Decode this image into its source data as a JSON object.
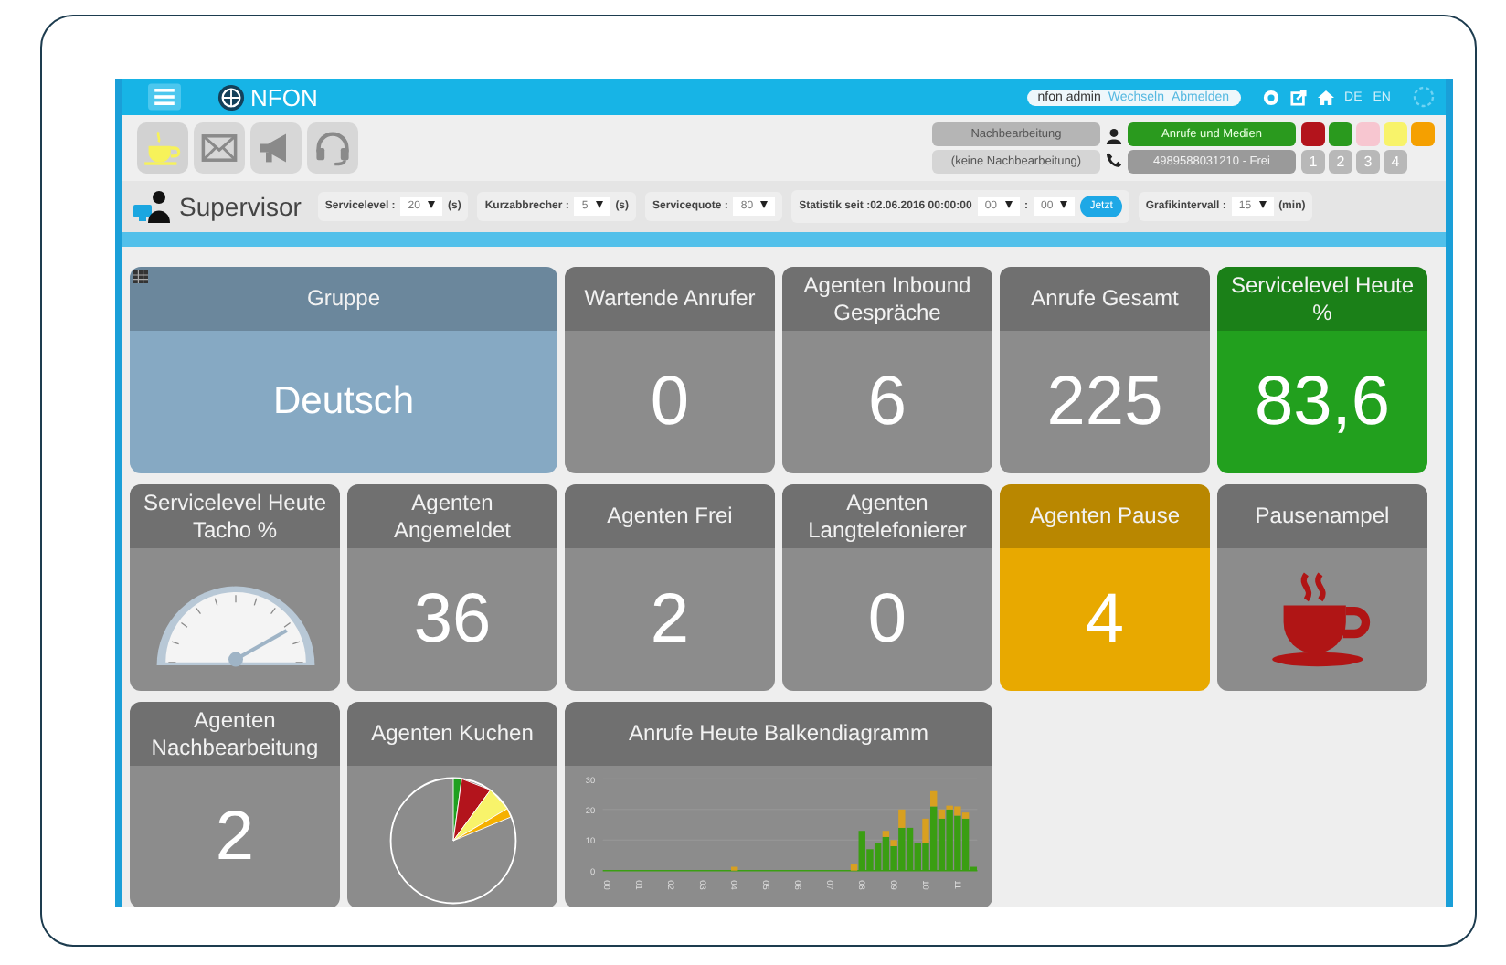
{
  "header": {
    "logo": "NFON",
    "user": "nfon admin",
    "links": [
      "Wechseln",
      "Abmelden"
    ],
    "languages": [
      "DE",
      "EN"
    ]
  },
  "toolbar": {
    "modes": [
      {
        "kind": "coffee",
        "selected": true
      },
      {
        "kind": "mail",
        "selected": false
      },
      {
        "kind": "megaphone",
        "selected": false
      },
      {
        "kind": "headset",
        "selected": false
      }
    ],
    "wrapup": {
      "button": "Nachbearbeitung",
      "status": "(keine Nachbearbeitung)"
    },
    "media": {
      "button": "Anrufe und Medien",
      "line": "4989588031210 - Frei"
    },
    "status_colors": [
      {
        "color": "#b3141c"
      },
      {
        "color": "#2a9a1e"
      },
      {
        "color": "#f7c6d0"
      },
      {
        "color": "#f8f36a"
      },
      {
        "color": "#f5a000"
      }
    ],
    "lines": [
      "1",
      "2",
      "3",
      "4"
    ]
  },
  "supervisor": {
    "title": "Supervisor",
    "settings": [
      {
        "label": "Servicelevel :",
        "value": "20",
        "unit": "(s)"
      },
      {
        "label": "Kurzabbrecher :",
        "value": "5",
        "unit": "(s)"
      },
      {
        "label": "Servicequote :",
        "value": "80"
      }
    ],
    "since": {
      "label": "Statistik seit :02.06.2016 00:00:00",
      "hour": "00",
      "separator": ":",
      "minute": "00",
      "button": "Jetzt"
    },
    "interval": {
      "label": "Grafikintervall :",
      "value": "15",
      "unit": "(min)"
    }
  },
  "tiles": [
    {
      "kind": "text",
      "title": "Gruppe",
      "value": "Deutsch",
      "color": "#86a9c3",
      "wide": true
    },
    {
      "kind": "number",
      "title": "Wartende Anrufer",
      "value": "0",
      "color": "#8c8c8c",
      "wide": false
    },
    {
      "kind": "number",
      "title": "Agenten Inbound Gespräche",
      "value": "6",
      "color": "#8c8c8c",
      "wide": false
    },
    {
      "kind": "number",
      "title": "Anrufe Gesamt",
      "value": "225",
      "color": "#8c8c8c",
      "wide": false
    },
    {
      "kind": "number",
      "title": "Servicelevel Heute %",
      "value": "83,6",
      "color": "#22a01e",
      "wide": false
    },
    {
      "kind": "gauge",
      "title": "Servicelevel Heute Tacho %",
      "level": 0.836,
      "color": "#8c8c8c",
      "wide": false
    },
    {
      "kind": "number",
      "title": "Agenten Angemeldet",
      "value": "36",
      "color": "#8c8c8c",
      "wide": false
    },
    {
      "kind": "number",
      "title": "Agenten Frei",
      "value": "2",
      "color": "#8c8c8c",
      "wide": false
    },
    {
      "kind": "number",
      "title": "Agenten Langtelefonierer",
      "value": "0",
      "color": "#8c8c8c",
      "wide": false
    },
    {
      "kind": "number",
      "title": "Agenten Pause",
      "value": "4",
      "color": "#e8a900",
      "wide": false
    },
    {
      "kind": "cup",
      "title": "Pausenampel",
      "color": "#8c8c8c",
      "wide": false
    },
    {
      "kind": "number",
      "title": "Agenten Nachbearbeitung",
      "value": "2",
      "color": "#8c8c8c",
      "wide": false
    },
    {
      "kind": "pie",
      "title": "Agenten Kuchen",
      "color": "#8c8c8c",
      "wide": false
    },
    {
      "kind": "bar",
      "title": "Anrufe Heute Balkendiagramm",
      "color": "#8c8c8c",
      "wide": true,
      "chart_data": {
        "type": "bar",
        "stacked": true,
        "categories": [
          "00",
          null,
          null,
          null,
          "01",
          null,
          null,
          null,
          "02",
          null,
          null,
          null,
          "03",
          null,
          null,
          null,
          "04",
          null,
          null,
          null,
          "05",
          null,
          null,
          null,
          "06",
          null,
          null,
          null,
          "07",
          null,
          null,
          null,
          "08",
          null,
          null,
          null,
          "09",
          null,
          null,
          null,
          "10",
          null,
          null,
          null,
          "11",
          null,
          null
        ],
        "ylim": [
          0,
          30
        ],
        "yticks": [
          0,
          10,
          20,
          30
        ],
        "series": [
          {
            "color": "#3a9e12",
            "values": [
              0,
              0,
              0,
              0,
              0,
              0,
              0,
              0,
              0,
              0,
              0,
              0,
              0,
              0,
              0,
              0,
              0,
              0,
              0,
              0,
              0,
              0,
              0,
              0,
              0,
              0,
              0,
              0,
              0,
              0,
              0,
              0,
              13,
              7,
              9,
              11,
              8,
              14,
              14,
              9,
              9,
              21,
              17,
              20,
              18,
              17,
              1
            ]
          },
          {
            "color": "#d8a020",
            "values": [
              0,
              0,
              0,
              0,
              0,
              0,
              0,
              0,
              0,
              0,
              0,
              0,
              0,
              0,
              0,
              0,
              1,
              0,
              0,
              0,
              0,
              0,
              0,
              0,
              0,
              0,
              0,
              0,
              0,
              0,
              0,
              2,
              0,
              0,
              0,
              2,
              2,
              6,
              0,
              0,
              8,
              5,
              3,
              1,
              3,
              2,
              0
            ]
          }
        ]
      }
    }
  ]
}
